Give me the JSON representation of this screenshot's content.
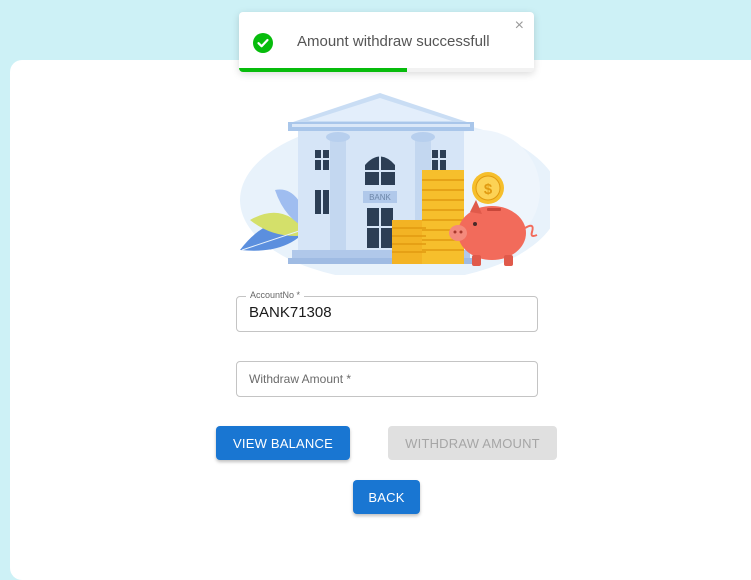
{
  "toast": {
    "message": "Amount withdraw successfull",
    "close_glyph": "×",
    "icon": "check-circle-icon",
    "progress": 0.57,
    "accent_color": "#07bc0c"
  },
  "form": {
    "account": {
      "label": "AccountNo *",
      "value": "BANK71308"
    },
    "withdraw": {
      "placeholder": "Withdraw Amount *"
    }
  },
  "buttons": {
    "view_balance": "VIEW BALANCE",
    "withdraw_amount": "WITHDRAW AMOUNT",
    "back": "BACK"
  },
  "illustration": {
    "icon": "bank-illustration",
    "sign_text": "BANK",
    "coin_symbol": "$"
  },
  "colors": {
    "background": "#cdf1f6",
    "primary": "#1976d2",
    "disabled": "#e0e0e0"
  }
}
